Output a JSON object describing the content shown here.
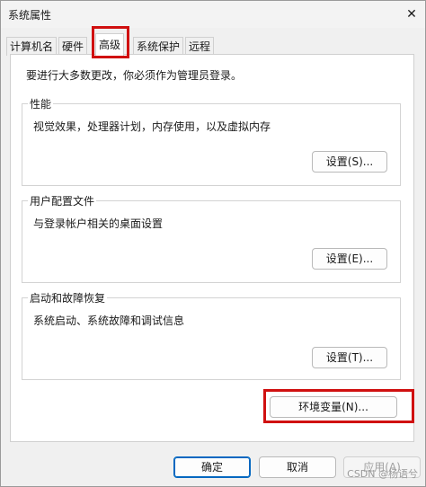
{
  "window": {
    "title": "系统属性",
    "close_glyph": "✕"
  },
  "tabs": [
    {
      "label": "计算机名",
      "active": false
    },
    {
      "label": "硬件",
      "active": false
    },
    {
      "label": "高级",
      "active": true
    },
    {
      "label": "系统保护",
      "active": false
    },
    {
      "label": "远程",
      "active": false
    }
  ],
  "admin_note": "要进行大多数更改，你必须作为管理员登录。",
  "groups": [
    {
      "title": "性能",
      "desc": "视觉效果，处理器计划，内存使用，以及虚拟内存",
      "button": "设置(S)..."
    },
    {
      "title": "用户配置文件",
      "desc": "与登录帐户相关的桌面设置",
      "button": "设置(E)..."
    },
    {
      "title": "启动和故障恢复",
      "desc": "系统启动、系统故障和调试信息",
      "button": "设置(T)..."
    }
  ],
  "env_button": "环境变量(N)...",
  "footer": {
    "ok": "确定",
    "cancel": "取消",
    "apply": "应用(A)"
  },
  "watermark": "CSDN @杨语兮",
  "colors": {
    "highlight": "#d01010",
    "accent": "#0067c0"
  }
}
